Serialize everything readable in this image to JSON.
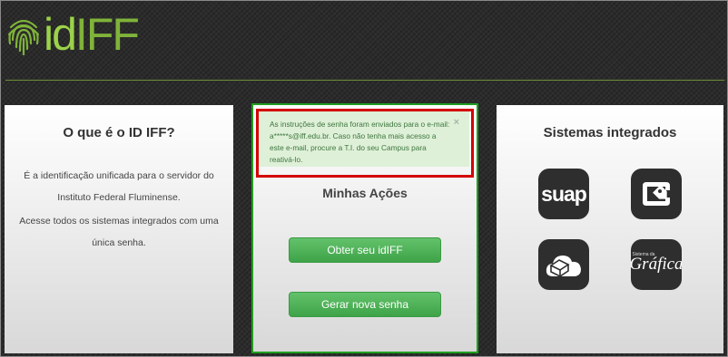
{
  "header": {
    "logo_text_id": "id",
    "logo_text_rest": "IFF",
    "logo_icon": "fingerprint-icon",
    "accent_color": "#7fb33a"
  },
  "left_card": {
    "title": "O que é o ID IFF?",
    "paragraph1": "É a identificação unificada para o servidor do Instituto Federal Fluminense.",
    "paragraph2": "Acesse todos os sistemas integrados com uma única senha."
  },
  "middle_card": {
    "alert": {
      "message": "As instruções de senha foram enviados para o e-mail: a*****s@iff.edu.br. Caso não tenha mais acesso a este e-mail, procure a T.I. do seu Campus para reativá-lo.",
      "close_glyph": "×",
      "color": "#dff0d8"
    },
    "title": "Minhas Ações",
    "buttons": [
      {
        "label": "Obter seu idIFF"
      },
      {
        "label": "Gerar nova senha"
      }
    ],
    "button_color": "#4cae55"
  },
  "right_card": {
    "title": "Sistemas integrados",
    "systems": [
      {
        "label": "suap",
        "icon": "suap-icon"
      },
      {
        "icon": "tag-icon"
      },
      {
        "icon": "cloud-box-icon"
      },
      {
        "label_small": "Sistema da",
        "label": "Gráfica",
        "icon": "grafica-icon"
      }
    ]
  }
}
